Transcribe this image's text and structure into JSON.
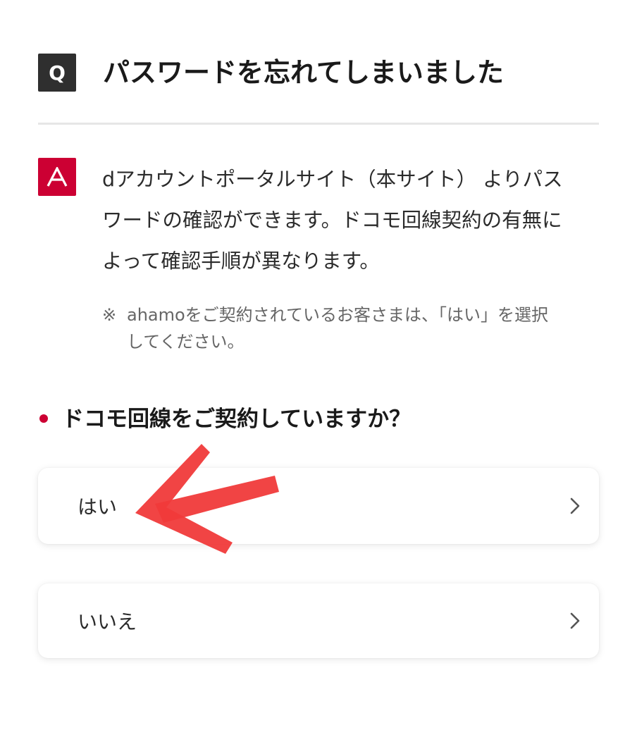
{
  "faq": {
    "q_badge": "Q",
    "question_title": "パスワードを忘れてしまいました",
    "a_badge_icon": "a-letter-icon",
    "answer_lines": [
      "dアカウントポータルサイト（本サイト） よりパス",
      "ワードの確認ができます。ドコモ回線契約の有無に",
      "よって確認手順が異なります。"
    ],
    "note_mark": "※",
    "note_lines": [
      "ahamoをご契約されているお客さまは、「はい」を選択",
      "してください。"
    ]
  },
  "prompt": {
    "question": "ドコモ回線をご契約していますか？"
  },
  "choices": [
    {
      "label": "はい",
      "icon": "chevron-right-icon"
    },
    {
      "label": "いいえ",
      "icon": "chevron-right-icon"
    }
  ],
  "annotation": {
    "icon": "red-arrow-icon",
    "color": "#f03a3a"
  },
  "colors": {
    "accent": "#cc0033",
    "q_badge_bg": "#2f2f2f",
    "divider": "#e6e6e6"
  }
}
